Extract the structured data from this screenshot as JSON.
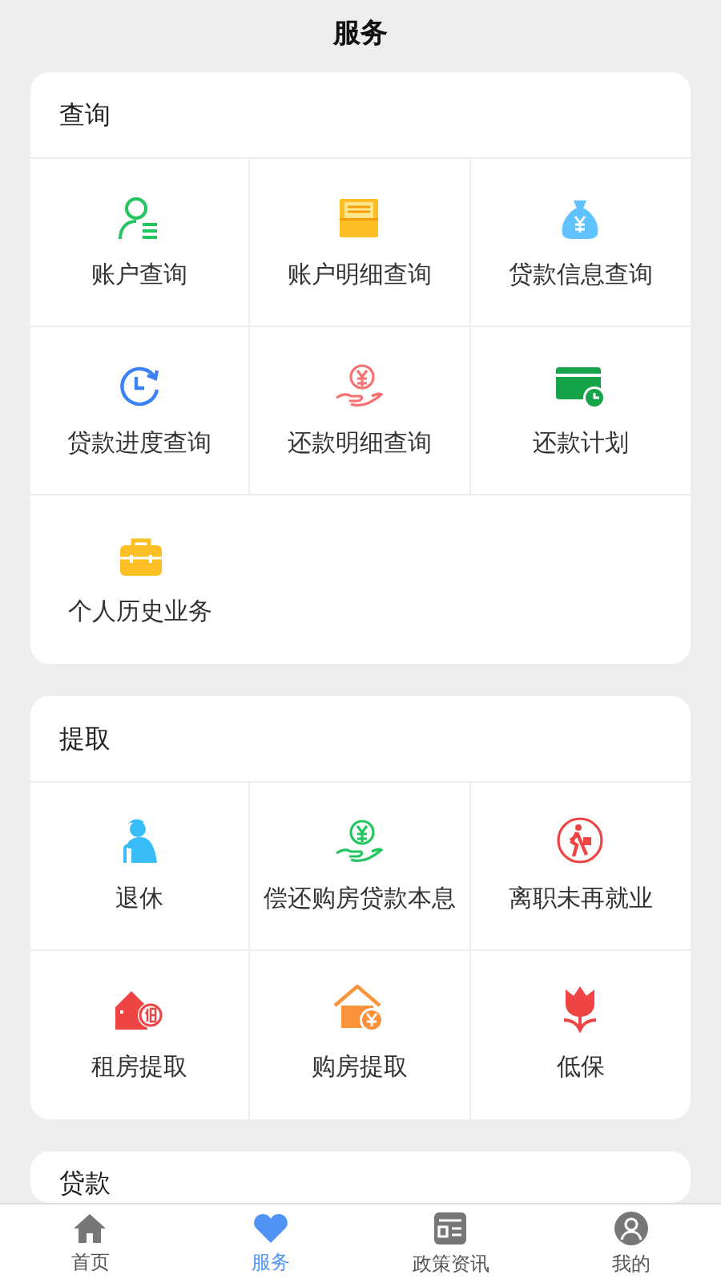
{
  "header": {
    "title": "服务"
  },
  "sections": [
    {
      "title": "查询",
      "items": [
        {
          "label": "账户查询"
        },
        {
          "label": "账户明细查询"
        },
        {
          "label": "贷款信息查询"
        },
        {
          "label": "贷款进度查询"
        },
        {
          "label": "还款明细查询"
        },
        {
          "label": "还款计划"
        },
        {
          "label": "个人历史业务"
        }
      ]
    },
    {
      "title": "提取",
      "items": [
        {
          "label": "退休"
        },
        {
          "label": "偿还购房贷款本息"
        },
        {
          "label": "离职未再就业"
        },
        {
          "label": "租房提取"
        },
        {
          "label": "购房提取"
        },
        {
          "label": "低保"
        }
      ]
    },
    {
      "title": "贷款"
    }
  ],
  "tab_bar": [
    {
      "label": "首页",
      "selected": false
    },
    {
      "label": "服务",
      "selected": true
    },
    {
      "label": "政策资讯",
      "selected": false
    },
    {
      "label": "我的",
      "selected": false
    }
  ]
}
